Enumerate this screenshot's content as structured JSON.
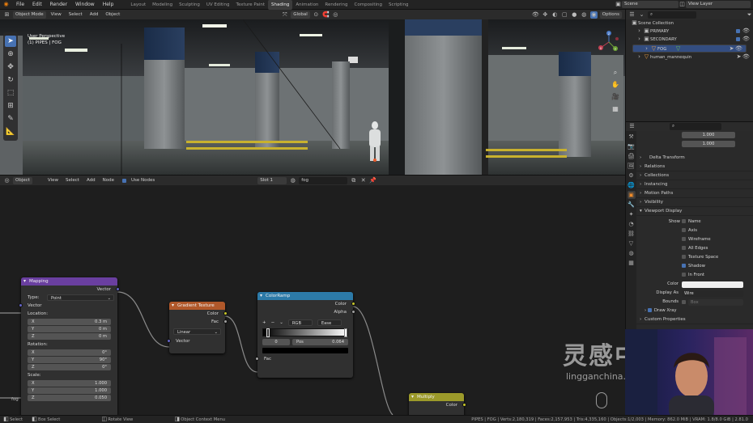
{
  "topbar": {
    "menus": [
      "File",
      "Edit",
      "Render",
      "Window",
      "Help"
    ],
    "workspaces": [
      "Layout",
      "Modeling",
      "Sculpting",
      "UV Editing",
      "Texture Paint",
      "Shading",
      "Animation",
      "Rendering",
      "Compositing",
      "Scripting"
    ],
    "active_workspace": "Shading",
    "scene": "Scene",
    "view_layer": "View Layer"
  },
  "viewport": {
    "mode": "Object Mode",
    "menus": [
      "View",
      "Select",
      "Add",
      "Object"
    ],
    "orientation": "Global",
    "options": "Options",
    "info_line1": "User Perspective",
    "info_line2": "(1) PIPES | FOG",
    "gizmo": {
      "x": "X",
      "y": "Y",
      "z": "Z"
    }
  },
  "node_editor": {
    "editor_type": "Object",
    "menus": [
      "View",
      "Select",
      "Add",
      "Node"
    ],
    "use_nodes": "Use Nodes",
    "slot": "Slot 1",
    "material": "fog",
    "left_label": "fog"
  },
  "nodes": {
    "mapping": {
      "title": "Mapping",
      "out_vector": "Vector",
      "type_label": "Type:",
      "type_value": "Point",
      "in_vector": "Vector",
      "location": "Location:",
      "loc": [
        {
          "a": "X",
          "v": "0.3 m"
        },
        {
          "a": "Y",
          "v": "0 m"
        },
        {
          "a": "Z",
          "v": "0 m"
        }
      ],
      "rotation": "Rotation:",
      "rot": [
        {
          "a": "X",
          "v": "0°"
        },
        {
          "a": "Y",
          "v": "90°"
        },
        {
          "a": "Z",
          "v": "0°"
        }
      ],
      "scale": "Scale:",
      "scl": [
        {
          "a": "X",
          "v": "1.000"
        },
        {
          "a": "Y",
          "v": "1.000"
        },
        {
          "a": "Z",
          "v": "0.050"
        }
      ]
    },
    "gradient": {
      "title": "Gradient Texture",
      "out_color": "Color",
      "out_fac": "Fac",
      "type_value": "Linear",
      "in_vector": "Vector"
    },
    "colorramp": {
      "title": "ColorRamp",
      "out_color": "Color",
      "out_alpha": "Alpha",
      "plus": "+",
      "minus": "−",
      "mode": "RGB",
      "interp": "Ease",
      "stop_index": "0",
      "pos_label": "Pos",
      "pos_value": "0.064",
      "in_fac": "Fac"
    },
    "multiply": {
      "title": "Multiply",
      "out_color": "Color"
    }
  },
  "outliner": {
    "root": "Scene Collection",
    "items": [
      {
        "name": "PRIMARY"
      },
      {
        "name": "SECONDARY"
      },
      {
        "name": "FOG"
      },
      {
        "name": "human_mannequin"
      }
    ]
  },
  "properties": {
    "search_placeholder": "",
    "y_label": "Y",
    "y_value": "1.000",
    "z_label": "Z",
    "z_value": "1.000",
    "delta": "Delta Transform",
    "panels": [
      "Relations",
      "Collections",
      "Instancing",
      "Motion Paths",
      "Visibility"
    ],
    "viewport_display": "Viewport Display",
    "show_label": "Show",
    "show_items": [
      {
        "label": "Name",
        "checked": false
      },
      {
        "label": "Axis",
        "checked": false
      },
      {
        "label": "Wireframe",
        "checked": false
      },
      {
        "label": "All Edges",
        "checked": false
      },
      {
        "label": "Texture Space",
        "checked": false
      },
      {
        "label": "Shadow",
        "checked": true
      },
      {
        "label": "In Front",
        "checked": false
      }
    ],
    "color_label": "Color",
    "display_as_label": "Display As",
    "display_as_value": "Wire",
    "bounds_label": "Bounds",
    "bounds_value": "Box",
    "draw_xray": "Draw Xray",
    "custom_properties": "Custom Properties"
  },
  "status": {
    "select": "Select",
    "box_select": "Box Select",
    "rotate_view": "Rotate View",
    "context_menu": "Object Context Menu",
    "stats": "PIPES | FOG | Verts:2,180,319 | Faces:2,157,953 | Tris:4,335,160 | Objects:1/2,003 | Memory: 862.0 MiB | VRAM: 1.8/8.0 GiB | 2.81.0"
  },
  "watermark": {
    "cn": "灵感中国",
    "url": "lingganchina.com"
  },
  "colors": {
    "accent": "#4772b3",
    "mapping_header": "#6a3fa0",
    "texture_header": "#b0582a",
    "converter_header": "#2c7aa8",
    "color_header": "#9c9a2a"
  }
}
